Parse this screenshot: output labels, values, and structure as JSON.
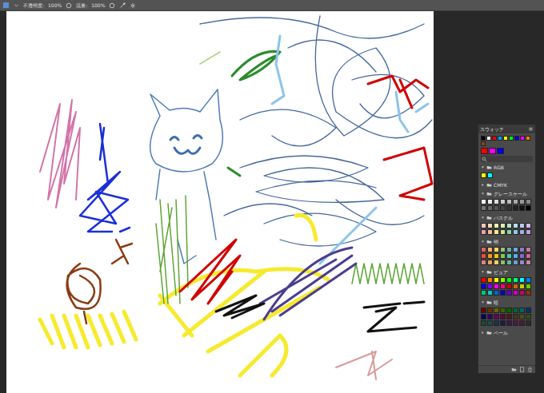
{
  "toolbar": {
    "items": [
      "不透明度:",
      "100%",
      "流量:",
      "100%"
    ]
  },
  "canvas": {
    "strokes": [
      {
        "color": "#46689c"
      },
      {
        "color": "#4f7bb8"
      },
      {
        "color": "#3f6fae"
      },
      {
        "color": "#d373a8"
      },
      {
        "color": "#1a2fd6"
      },
      {
        "color": "#8b3a12"
      },
      {
        "color": "#f7ea2e"
      },
      {
        "color": "#5ea535"
      },
      {
        "color": "#2c8c2c"
      },
      {
        "color": "#d00000"
      },
      {
        "color": "#8cc4ea"
      },
      {
        "color": "#4b3d8f"
      },
      {
        "color": "#111111"
      },
      {
        "color": "#d89a9a"
      },
      {
        "color": "#a8d080"
      }
    ]
  },
  "panel": {
    "title": "スウォッチ",
    "recent": [
      "#000000",
      "#ffffff",
      "#ff0000",
      "#00a0ff",
      "#ffff00",
      "#00ff00",
      "#0000ff",
      "#ff00ff",
      "#ff8000",
      "#8b4513"
    ],
    "big": [
      "#ff0000",
      "#ff00ff",
      "#0000ff"
    ],
    "groups": [
      {
        "label": "RGB",
        "expanded": true,
        "swatches": [
          "#ffff00",
          "#00ffff"
        ]
      },
      {
        "label": "CMYK",
        "expanded": false,
        "swatches": []
      },
      {
        "label": "グレースケール",
        "expanded": true,
        "swatches": [
          "#ffffff",
          "#eeeeee",
          "#dddddd",
          "#cccccc",
          "#bbbbbb",
          "#aaaaaa",
          "#999999",
          "#888888",
          "#777777",
          "#666666",
          "#555555",
          "#444444",
          "#333333",
          "#222222",
          "#111111",
          "#000000"
        ]
      },
      {
        "label": "パステル",
        "expanded": true,
        "swatches": [
          "#f4c7c3",
          "#f8d9b0",
          "#fff2b0",
          "#d9efb0",
          "#b7e1cd",
          "#b0e0e8",
          "#b8c8f0",
          "#d0b8f0",
          "#e8a0b0",
          "#f0c090",
          "#f8e890",
          "#c8e890",
          "#90d0b0",
          "#90c8e0",
          "#a0b0e8",
          "#c0a0e0"
        ]
      },
      {
        "label": "明",
        "expanded": true,
        "swatches": [
          "#e06666",
          "#f6b26b",
          "#ffd966",
          "#93c47d",
          "#76a5af",
          "#6fa8dc",
          "#8e7cc3",
          "#c27ba0",
          "#e84c3d",
          "#f39c12",
          "#f1c40f",
          "#7dc85b",
          "#48c9b0",
          "#5dade2",
          "#7f6ad1",
          "#d35f9a",
          "#d98880",
          "#e5a55f",
          "#e9d16b",
          "#8fbf6a",
          "#6bb5a5",
          "#6a9fd0",
          "#9a88c8",
          "#c08aa8"
        ]
      },
      {
        "label": "ピュア",
        "expanded": true,
        "swatches": [
          "#ff0000",
          "#ff8000",
          "#ffff00",
          "#80ff00",
          "#00ff00",
          "#00ff80",
          "#00ffff",
          "#0080ff",
          "#0000ff",
          "#8000ff",
          "#ff00ff",
          "#ff0080",
          "#cc0000",
          "#cc6600",
          "#cccc00",
          "#66cc00",
          "#00cc66",
          "#00cccc",
          "#0066cc",
          "#0000cc",
          "#6600cc",
          "#cc00cc",
          "#cc0066",
          "#993300"
        ]
      },
      {
        "label": "暗",
        "expanded": true,
        "swatches": [
          "#660000",
          "#663300",
          "#666600",
          "#336600",
          "#006600",
          "#006633",
          "#006666",
          "#003366",
          "#000066",
          "#330066",
          "#660066",
          "#660033",
          "#4d1a1a",
          "#4d331a",
          "#4d4d1a",
          "#334d1a",
          "#1a4d33",
          "#1a4d4d",
          "#1a334d",
          "#1a1a4d",
          "#331a4d",
          "#4d1a4d",
          "#4d1a33",
          "#2b2b2b"
        ]
      },
      {
        "label": "ペール",
        "expanded": false,
        "swatches": []
      }
    ]
  }
}
